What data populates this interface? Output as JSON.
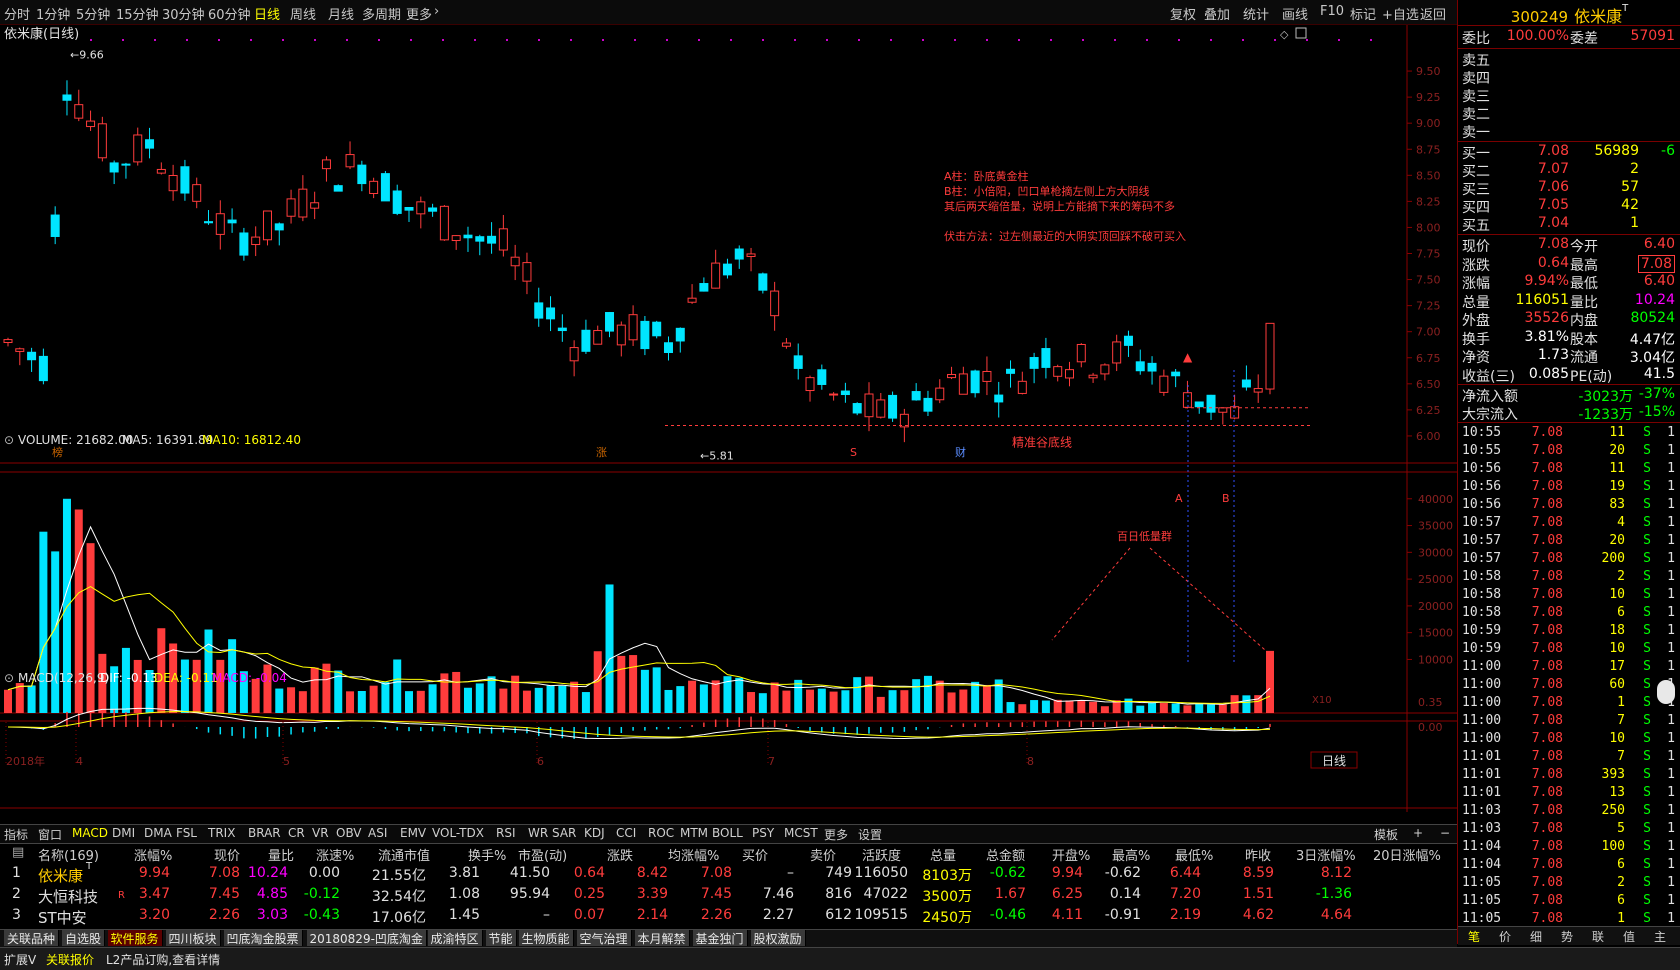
{
  "toolbar": {
    "periods": [
      "分时",
      "1分钟",
      "5分钟",
      "15分钟",
      "30分钟",
      "60分钟",
      "日线",
      "周线",
      "月线",
      "多周期",
      "更多"
    ],
    "active_period": "日线",
    "right": [
      "复权",
      "叠加",
      "统计",
      "画线",
      "F10",
      "标记",
      "+自选",
      "返回"
    ]
  },
  "chart": {
    "title": "依米康(日线)",
    "high_label": "9.66",
    "low_label": "5.81",
    "annotations": {
      "lines": [
        "A柱：卧底黄金柱",
        "B柱：小倍阳，凹口单枪摘左侧上方大阴线",
        "其后两天缩倍量，说明上方能摘下来的筹码不多",
        "",
        "伏击方法：过左侧最近的大阴实顶回踩不破可买入"
      ],
      "precise_bottom": "精准谷底线",
      "vol_group": "百日低量群",
      "mark_a": "A",
      "mark_b": "B"
    },
    "markers": [
      "榜",
      "涨",
      "S",
      "财"
    ],
    "price_axis": [
      "9.50",
      "9.25",
      "9.00",
      "8.75",
      "8.50",
      "8.25",
      "8.00",
      "7.75",
      "7.50",
      "7.25",
      "7.00",
      "6.75",
      "6.50",
      "6.25",
      "6.00"
    ],
    "volume_header": {
      "label": "VOLUME: 21682.00",
      "ma5": "MA5: 16391.89",
      "ma10": "MA10: 16812.40"
    },
    "volume_axis": [
      "40000",
      "35000",
      "30000",
      "25000",
      "20000",
      "15000",
      "10000"
    ],
    "volume_unit": "X10",
    "macd_header": {
      "label": "MACD(12,26,9)",
      "dif": "DIF: -0.13",
      "dea": "DEA: -0.11",
      "macd": "MACD: -0.04"
    },
    "macd_axis": [
      "0.35",
      "0.00"
    ],
    "date_labels": [
      "2018年",
      "4",
      "5",
      "6",
      "7",
      "8"
    ],
    "period_box": "日线"
  },
  "indicator_tabs": [
    "指标",
    "窗口",
    "MACD",
    "DMI",
    "DMA",
    "FSL",
    "TRIX",
    "BRAR",
    "CR",
    "VR",
    "OBV",
    "ASI",
    "EMV",
    "VOL-TDX",
    "RSI",
    "WR",
    "SAR",
    "KDJ",
    "CCI",
    "ROC",
    "MTM",
    "BOLL",
    "PSY",
    "MCST",
    "更多",
    "设置"
  ],
  "indicator_active": "MACD",
  "indicator_right": [
    "模板",
    "+",
    "−"
  ],
  "table": {
    "headers": [
      "名称(169)",
      "涨幅%",
      "现价",
      "量比",
      "涨速%",
      "流通市值",
      "换手%",
      "市盈(动)",
      "涨跌",
      "均涨幅%",
      "买价",
      "卖价",
      "活跃度",
      "总量",
      "总金额",
      "开盘%",
      "最高%",
      "最低%",
      "昨收",
      "3日涨幅%",
      "20日涨幅%"
    ],
    "rows": [
      {
        "idx": "1",
        "name": "依米康",
        "sup": "T",
        "flag": "",
        "cells": [
          "9.94",
          "7.08",
          "10.24",
          "0.00",
          "21.55亿",
          "3.81",
          "41.50",
          "0.64",
          "8.42",
          "7.08",
          "–",
          "749",
          "116050",
          "8103万",
          "-0.62",
          "9.94",
          "-0.62",
          "6.44",
          "8.59",
          "8.12"
        ]
      },
      {
        "idx": "2",
        "name": "大恒科技",
        "sup": "",
        "flag": "R",
        "cells": [
          "3.47",
          "7.45",
          "4.85",
          "-0.12",
          "32.54亿",
          "1.08",
          "95.94",
          "0.25",
          "3.39",
          "7.45",
          "7.46",
          "816",
          "47022",
          "3500万",
          "1.67",
          "6.25",
          "0.14",
          "7.20",
          "1.51",
          "-1.36"
        ]
      },
      {
        "idx": "3",
        "name": "ST中安",
        "sup": "",
        "flag": "",
        "cells": [
          "3.20",
          "2.26",
          "3.03",
          "-0.43",
          "17.06亿",
          "1.45",
          "–",
          "0.07",
          "2.14",
          "2.26",
          "2.27",
          "612",
          "109515",
          "2450万",
          "-0.46",
          "4.11",
          "-0.91",
          "2.19",
          "4.62",
          "4.64"
        ]
      }
    ]
  },
  "sector_tabs": [
    "关联品种",
    "自选股",
    "软件服务",
    "四川板块",
    "凹底淘金股票",
    "20180829-凹底淘金",
    "成渝特区",
    "节能",
    "生物质能",
    "空气治理",
    "本月解禁",
    "基金独门",
    "股权激励"
  ],
  "sector_active": "软件服务",
  "status": {
    "left": "扩展V",
    "mid": "关联报价",
    "info": "L2产品订购,查看详情"
  },
  "quote": {
    "code": "300249",
    "name": "依米康",
    "sup": "T",
    "wb_label": "委比",
    "wb": "100.00%",
    "wc_label": "委差",
    "wc": "57091",
    "sells": [
      {
        "l": "卖五"
      },
      {
        "l": "卖四"
      },
      {
        "l": "卖三"
      },
      {
        "l": "卖二"
      },
      {
        "l": "卖一"
      }
    ],
    "buys": [
      {
        "l": "买一",
        "p": "7.08",
        "v": "56989",
        "c": "-6"
      },
      {
        "l": "买二",
        "p": "7.07",
        "v": "2",
        "c": ""
      },
      {
        "l": "买三",
        "p": "7.06",
        "v": "57",
        "c": ""
      },
      {
        "l": "买四",
        "p": "7.05",
        "v": "42",
        "c": ""
      },
      {
        "l": "买五",
        "p": "7.04",
        "v": "1",
        "c": ""
      }
    ],
    "stats": [
      {
        "l1": "现价",
        "v1": "7.08",
        "l2": "今开",
        "v2": "6.40"
      },
      {
        "l1": "涨跌",
        "v1": "0.64",
        "l2": "最高",
        "v2": "7.08"
      },
      {
        "l1": "涨幅",
        "v1": "9.94%",
        "l2": "最低",
        "v2": "6.40"
      },
      {
        "l1": "总量",
        "v1": "116051",
        "l2": "量比",
        "v2": "10.24"
      },
      {
        "l1": "外盘",
        "v1": "35526",
        "l2": "内盘",
        "v2": "80524"
      },
      {
        "l1": "换手",
        "v1": "3.81%",
        "l2": "股本",
        "v2": "4.47亿"
      },
      {
        "l1": "净资",
        "v1": "1.73",
        "l2": "流通",
        "v2": "3.04亿"
      },
      {
        "l1": "收益(三)",
        "v1": "0.085",
        "l2": "PE(动)",
        "v2": "41.5"
      }
    ],
    "flow": [
      {
        "l": "净流入额",
        "v": "-3023万",
        "p": "-37%"
      },
      {
        "l": "大宗流入",
        "v": "-1233万",
        "p": "-15%"
      }
    ],
    "ticks": [
      [
        "10:55",
        "7.08",
        "11",
        "S",
        "1"
      ],
      [
        "10:55",
        "7.08",
        "20",
        "S",
        "1"
      ],
      [
        "10:56",
        "7.08",
        "11",
        "S",
        "1"
      ],
      [
        "10:56",
        "7.08",
        "19",
        "S",
        "1"
      ],
      [
        "10:56",
        "7.08",
        "83",
        "S",
        "1"
      ],
      [
        "10:57",
        "7.08",
        "4",
        "S",
        "1"
      ],
      [
        "10:57",
        "7.08",
        "20",
        "S",
        "1"
      ],
      [
        "10:57",
        "7.08",
        "200",
        "S",
        "1"
      ],
      [
        "10:58",
        "7.08",
        "2",
        "S",
        "1"
      ],
      [
        "10:58",
        "7.08",
        "10",
        "S",
        "1"
      ],
      [
        "10:58",
        "7.08",
        "6",
        "S",
        "1"
      ],
      [
        "10:59",
        "7.08",
        "18",
        "S",
        "1"
      ],
      [
        "10:59",
        "7.08",
        "10",
        "S",
        "1"
      ],
      [
        "11:00",
        "7.08",
        "17",
        "S",
        "1"
      ],
      [
        "11:00",
        "7.08",
        "60",
        "S",
        "1"
      ],
      [
        "11:00",
        "7.08",
        "1",
        "S",
        "1"
      ],
      [
        "11:00",
        "7.08",
        "7",
        "S",
        "1"
      ],
      [
        "11:00",
        "7.08",
        "10",
        "S",
        "1"
      ],
      [
        "11:01",
        "7.08",
        "7",
        "S",
        "1"
      ],
      [
        "11:01",
        "7.08",
        "393",
        "S",
        "1"
      ],
      [
        "11:01",
        "7.08",
        "13",
        "S",
        "1"
      ],
      [
        "11:03",
        "7.08",
        "250",
        "S",
        "1"
      ],
      [
        "11:03",
        "7.08",
        "5",
        "S",
        "1"
      ],
      [
        "11:04",
        "7.08",
        "100",
        "S",
        "1"
      ],
      [
        "11:04",
        "7.08",
        "6",
        "S",
        "1"
      ],
      [
        "11:05",
        "7.08",
        "2",
        "S",
        "1"
      ],
      [
        "11:05",
        "7.08",
        "6",
        "S",
        "1"
      ],
      [
        "11:05",
        "7.08",
        "1",
        "S",
        "1"
      ]
    ],
    "bottom_tabs": [
      "笔",
      "价",
      "细",
      "势",
      "联",
      "值",
      "主"
    ]
  }
}
